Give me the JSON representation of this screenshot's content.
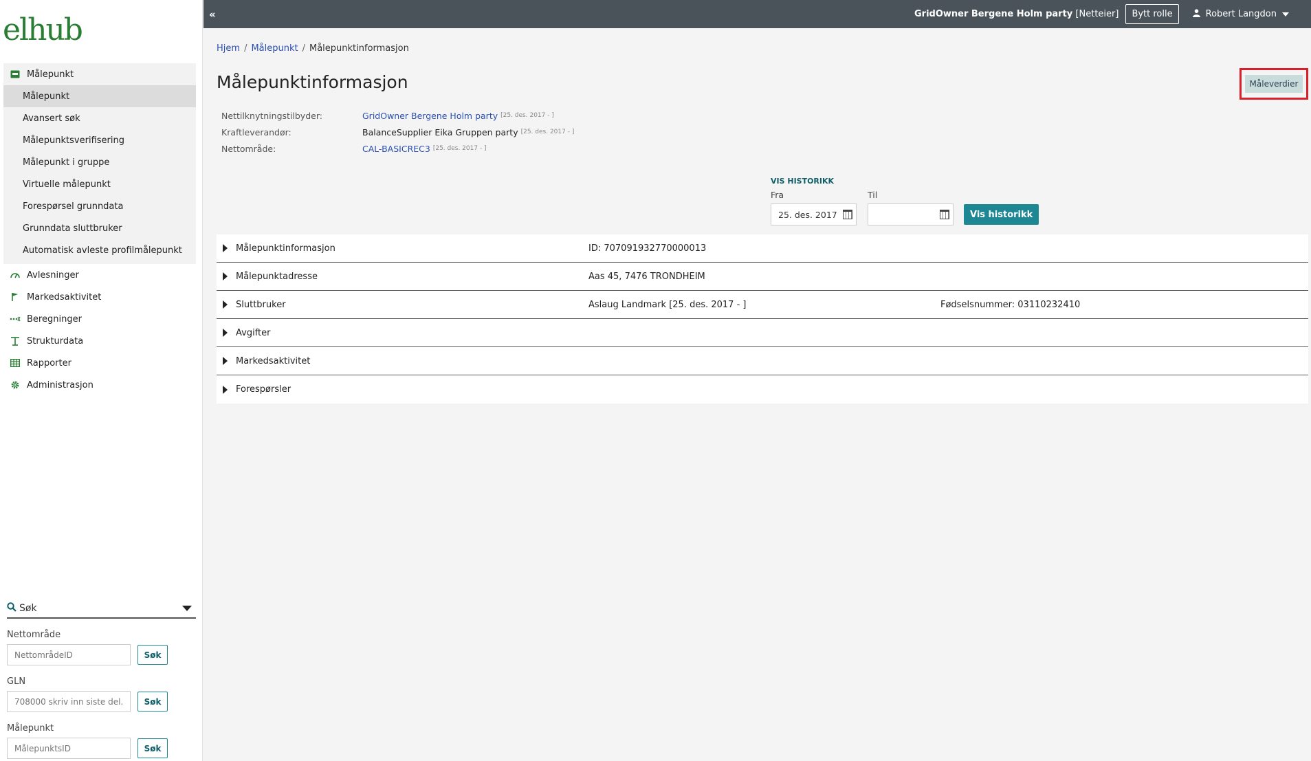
{
  "logo": "elhub",
  "nav": {
    "group": {
      "label": "Målepunkt",
      "icon": "meter-icon",
      "items": [
        "Målepunkt",
        "Avansert søk",
        "Målepunktsverifisering",
        "Målepunkt i gruppe",
        "Virtuelle målepunkt",
        "Forespørsel grunndata",
        "Grunndata sluttbruker",
        "Automatisk avleste profilmålepunkt"
      ],
      "active_item": "Målepunkt"
    },
    "top_items": [
      {
        "label": "Avlesninger",
        "icon": "gauge-icon"
      },
      {
        "label": "Markedsaktivitet",
        "icon": "flag-icon"
      },
      {
        "label": "Beregninger",
        "icon": "calculation-icon"
      },
      {
        "label": "Strukturdata",
        "icon": "pylon-icon"
      },
      {
        "label": "Rapporter",
        "icon": "table-icon"
      },
      {
        "label": "Administrasjon",
        "icon": "gear-icon"
      }
    ]
  },
  "search": {
    "header": "Søk",
    "fields": [
      {
        "label": "Nettområde",
        "placeholder": "NettområdeID",
        "button": "Søk"
      },
      {
        "label": "GLN",
        "placeholder": "708000 skriv inn siste del.",
        "button": "Søk"
      },
      {
        "label": "Målepunkt",
        "placeholder": "MålepunktsID",
        "button": "Søk"
      }
    ]
  },
  "topbar": {
    "collapse": "«",
    "role_name": "GridOwner Bergene Holm party",
    "role_type": "[Netteier]",
    "switch_role": "Bytt rolle",
    "user": "Robert Langdon"
  },
  "breadcrumb": [
    "Hjem",
    "Målepunkt",
    "Målepunktinformasjon"
  ],
  "page_title": "Målepunktinformasjon",
  "maleverdier_button": "Måleverdier",
  "info": [
    {
      "key": "Nettilknytningstilbyder:",
      "value": "GridOwner Bergene Holm party",
      "date": "[25. des. 2017 - ]",
      "link": true
    },
    {
      "key": "Kraftleverandør:",
      "value": "BalanceSupplier Eika Gruppen party",
      "date": "[25. des. 2017 - ]",
      "link": false
    },
    {
      "key": "Nettområde:",
      "value": "CAL-BASICREC3",
      "date": "[25. des. 2017 - ]",
      "link": true
    }
  ],
  "history": {
    "title": "VIS HISTORIKK",
    "from_label": "Fra",
    "to_label": "Til",
    "from_value": "25. des. 2017",
    "to_value": "",
    "button": "Vis historikk"
  },
  "accordion": [
    {
      "label": "Målepunktinformasjon",
      "value": "ID: 707091932770000013",
      "value2": ""
    },
    {
      "label": "Målepunktadresse",
      "value": "Aas 45, 7476 TRONDHEIM",
      "value2": ""
    },
    {
      "label": "Sluttbruker",
      "value": "Aslaug Landmark [25. des. 2017 - ]",
      "value2": "Fødselsnummer: 03110232410"
    },
    {
      "label": "Avgifter",
      "value": "",
      "value2": ""
    },
    {
      "label": "Markedsaktivitet",
      "value": "",
      "value2": ""
    },
    {
      "label": "Forespørsler",
      "value": "",
      "value2": ""
    }
  ]
}
